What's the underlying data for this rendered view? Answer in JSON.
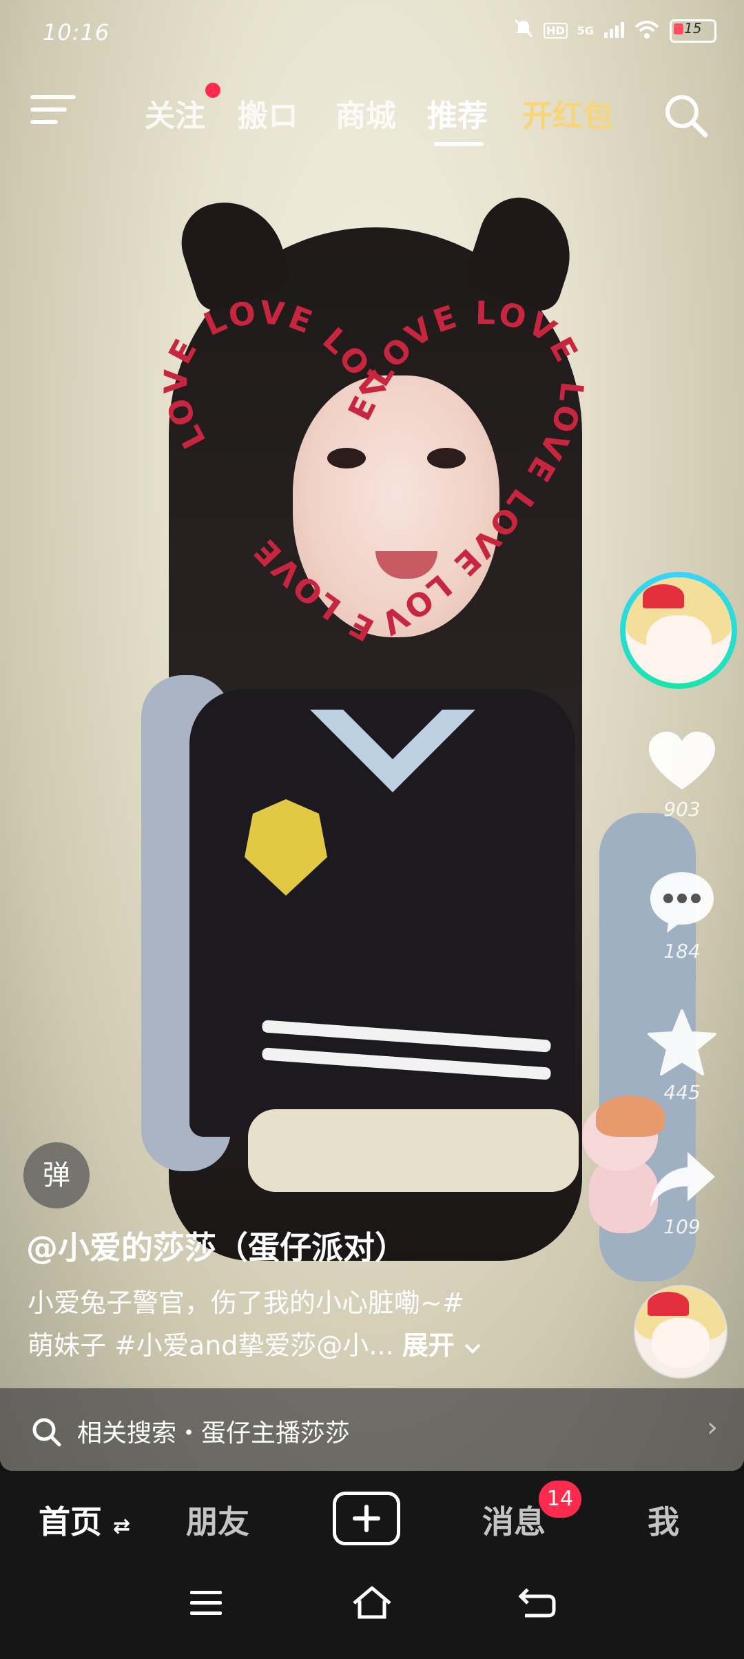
{
  "status_bar": {
    "time": "10:16",
    "network": "5G",
    "battery": "15",
    "icons": [
      "mute-icon",
      "hd-icon",
      "signal-icon",
      "wifi-icon",
      "battery-icon"
    ]
  },
  "top_nav": {
    "tabs": [
      {
        "label": "关注",
        "has_dot": true
      },
      {
        "label": "搬ロ"
      },
      {
        "label": "商城"
      },
      {
        "label": "推荐",
        "active": true
      },
      {
        "label": "开红包",
        "highlight": true
      }
    ],
    "hot_color": "#f7d67a"
  },
  "overlay": {
    "halo_text": "LOVE"
  },
  "right_rail": {
    "like_count": "903",
    "comment_count": "184",
    "favorite_count": "445",
    "share_count": "109"
  },
  "caption": {
    "danmaku_label": "弹",
    "author": "@小爱的莎莎（蛋仔派对）",
    "desc_line1": "小爱兔子警官，伤了我的小心脏嘞~#",
    "desc_line2": "萌妹子 #小爱and挚爱莎@小...",
    "expand": "展开"
  },
  "related_search": {
    "text": "相关搜索・蛋仔主播莎莎"
  },
  "bottom_nav": {
    "home": "首页",
    "friends": "朋友",
    "messages": "消息",
    "messages_badge": "14",
    "me": "我"
  }
}
